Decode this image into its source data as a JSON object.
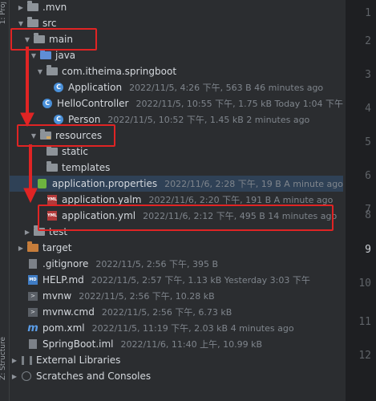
{
  "side_labels": {
    "top": "1: Proj",
    "bottom": "Z: Structure"
  },
  "rows": [
    {
      "name": ".mvn",
      "meta": "",
      "icon": "folder-icon"
    },
    {
      "name": "src",
      "meta": "",
      "icon": "folder-icon"
    },
    {
      "name": "main",
      "meta": "",
      "icon": "folder-icon"
    },
    {
      "name": "java",
      "meta": "",
      "icon": "folder-icon"
    },
    {
      "name": "com.itheima.springboot",
      "meta": "",
      "icon": "package-icon"
    },
    {
      "name": "Application",
      "meta": "2022/11/5, 4:26 下午, 563 B 46 minutes ago",
      "icon": "spring-class-icon"
    },
    {
      "name": "HelloController",
      "meta": "2022/11/5, 10:55 下午, 1.75 kB Today 1:04 下午",
      "icon": "class-icon"
    },
    {
      "name": "Person",
      "meta": "2022/11/5, 10:52 下午, 1.45 kB 2 minutes ago",
      "icon": "class-icon"
    },
    {
      "name": "resources",
      "meta": "",
      "icon": "resources-folder-icon"
    },
    {
      "name": "static",
      "meta": "",
      "icon": "folder-icon"
    },
    {
      "name": "templates",
      "meta": "",
      "icon": "folder-icon"
    },
    {
      "name": "application.properties",
      "meta": "2022/11/6, 2:28 下午, 19 B A minute ago",
      "icon": "properties-file-icon"
    },
    {
      "name": "application.yalm",
      "meta": "2022/11/6, 2:20 下午, 191 B A minute ago",
      "icon": "yml-file-icon"
    },
    {
      "name": "application.yml",
      "meta": "2022/11/6, 2:12 下午, 495 B 14 minutes ago",
      "icon": "yml-file-icon"
    },
    {
      "name": "test",
      "meta": "",
      "icon": "folder-icon"
    },
    {
      "name": "target",
      "meta": "",
      "icon": "folder-icon"
    },
    {
      "name": ".gitignore",
      "meta": "2022/11/5, 2:56 下午, 395 B",
      "icon": "gitignore-file-icon"
    },
    {
      "name": "HELP.md",
      "meta": "2022/11/5, 2:57 下午, 1.13 kB Yesterday 3:03 下午",
      "icon": "markdown-file-icon"
    },
    {
      "name": "mvnw",
      "meta": "2022/11/5, 2:56 下午, 10.28 kB",
      "icon": "shell-file-icon"
    },
    {
      "name": "mvnw.cmd",
      "meta": "2022/11/5, 2:56 下午, 6.73 kB",
      "icon": "shell-file-icon"
    },
    {
      "name": "pom.xml",
      "meta": "2022/11/5, 11:19 下午, 2.03 kB 4 minutes ago",
      "icon": "maven-icon"
    },
    {
      "name": "SpringBoot.iml",
      "meta": "2022/11/6, 11:40 上午, 10.99 kB",
      "icon": "iml-file-icon"
    },
    {
      "name": "External Libraries",
      "meta": "",
      "icon": "libraries-icon"
    },
    {
      "name": "Scratches and Consoles",
      "meta": "",
      "icon": "scratches-icon"
    }
  ],
  "gutter_lines": [
    "1",
    "2",
    "3",
    "4",
    "5",
    "6",
    "7",
    "8",
    "9",
    "10",
    "11",
    "12"
  ],
  "current_line": "9",
  "colors": {
    "highlight": "#e02424",
    "selection": "#2f4156"
  }
}
